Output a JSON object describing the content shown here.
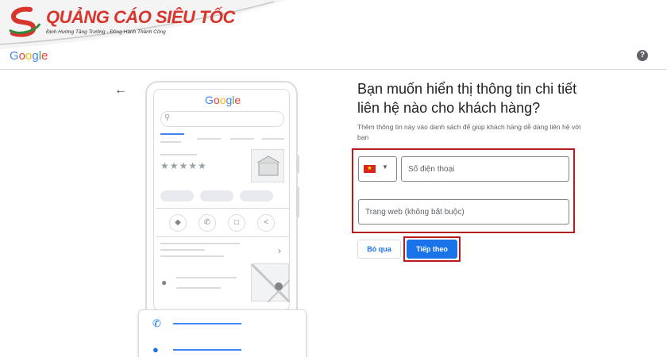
{
  "brand": {
    "name": "QUẢNG CÁO SIÊU TỐC",
    "tagline": "Định Hướng Tăng Trưởng - Đồng Hành Thành Công",
    "colors": {
      "red": "#d9342b",
      "green": "#2e8b3a"
    }
  },
  "header": {
    "logo_letters": [
      "G",
      "o",
      "o",
      "g",
      "l",
      "e"
    ],
    "help_label": "?"
  },
  "illustration": {
    "logo_letters": [
      "G",
      "o",
      "o",
      "g",
      "l",
      "e"
    ],
    "rating_stars": "★★★★★"
  },
  "form": {
    "heading": "Bạn muốn hiển thị thông tin chi tiết liên hệ nào cho khách hàng?",
    "description": "Thêm thông tin này vào danh sách để giúp khách hàng dễ dàng liên hệ với bạn",
    "phone_placeholder": "Số điện thoại",
    "website_placeholder": "Trang web (không bắt buộc)",
    "country_flag": "flag-vietnam-icon"
  },
  "actions": {
    "skip_label": "Bỏ qua",
    "next_label": "Tiếp theo"
  },
  "colors": {
    "google_blue": "#4285f4",
    "google_red": "#ea4335",
    "google_yellow": "#fbbc05",
    "google_green": "#34a853",
    "primary_button": "#1a73e8",
    "highlight": "#b71c1c"
  }
}
